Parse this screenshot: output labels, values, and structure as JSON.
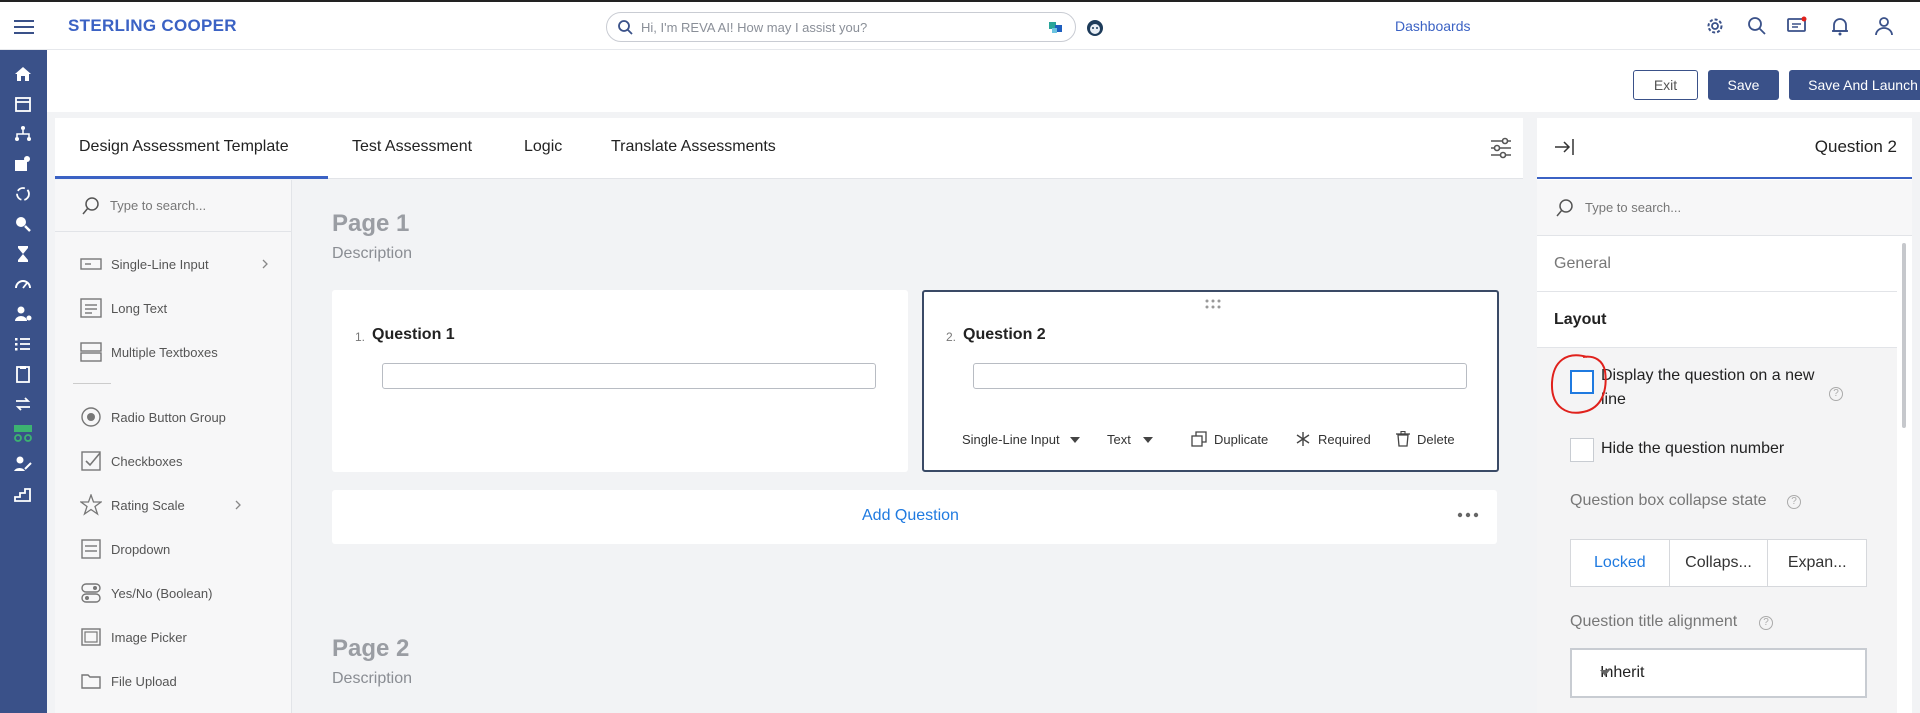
{
  "app": {
    "brand": "STERLING COOPER"
  },
  "search": {
    "placeholder": "Hi, I'm REVA AI! How may I assist you?"
  },
  "nav": {
    "dashboards": "Dashboards"
  },
  "actions": {
    "exit": "Exit",
    "save": "Save",
    "save_launch": "Save And Launch"
  },
  "tabs": [
    {
      "label": "Design Assessment Template",
      "active": true
    },
    {
      "label": "Test Assessment"
    },
    {
      "label": "Logic"
    },
    {
      "label": "Translate Assessments"
    }
  ],
  "toolbox": {
    "search_placeholder": "Type to search...",
    "items": [
      {
        "label": "Single-Line Input",
        "icon": "single-line-input-icon"
      },
      {
        "label": "Long Text",
        "icon": "long-text-icon"
      },
      {
        "label": "Multiple Textboxes",
        "icon": "multiple-textboxes-icon"
      },
      {
        "label": "Radio Button Group",
        "icon": "radio-icon"
      },
      {
        "label": "Checkboxes",
        "icon": "checkbox-icon"
      },
      {
        "label": "Rating Scale",
        "icon": "star-icon"
      },
      {
        "label": "Dropdown",
        "icon": "dropdown-icon"
      },
      {
        "label": "Yes/No (Boolean)",
        "icon": "toggle-icon"
      },
      {
        "label": "Image Picker",
        "icon": "image-icon"
      },
      {
        "label": "File Upload",
        "icon": "folder-icon"
      }
    ]
  },
  "canvas": {
    "page1": {
      "title": "Page 1",
      "description": "Description"
    },
    "page2": {
      "title": "Page 2",
      "description": "Description"
    },
    "questions": [
      {
        "num": "1.",
        "title": "Question 1"
      },
      {
        "num": "2.",
        "title": "Question 2"
      }
    ],
    "question_toolbar": {
      "type": "Single-Line Input",
      "input_type": "Text",
      "duplicate": "Duplicate",
      "required": "Required",
      "delete": "Delete"
    },
    "add_question": "Add Question"
  },
  "right_panel": {
    "title": "Question 2",
    "search_placeholder": "Type to search...",
    "sections": {
      "general": "General",
      "layout": "Layout"
    },
    "display_new_line": "Display the question on a new line",
    "hide_number": "Hide the question number",
    "collapse_state_label": "Question box collapse state",
    "collapse_options": [
      "Locked",
      "Collaps...",
      "Expan..."
    ],
    "collapse_selected": "Locked",
    "title_alignment_label": "Question title alignment",
    "title_alignment_value": "Inherit",
    "help_glyph": "?"
  },
  "colors": {
    "brand": "#3b62c4",
    "rail": "#3a5189",
    "accent": "#1f7ae0",
    "annotation": "#e0211c"
  }
}
